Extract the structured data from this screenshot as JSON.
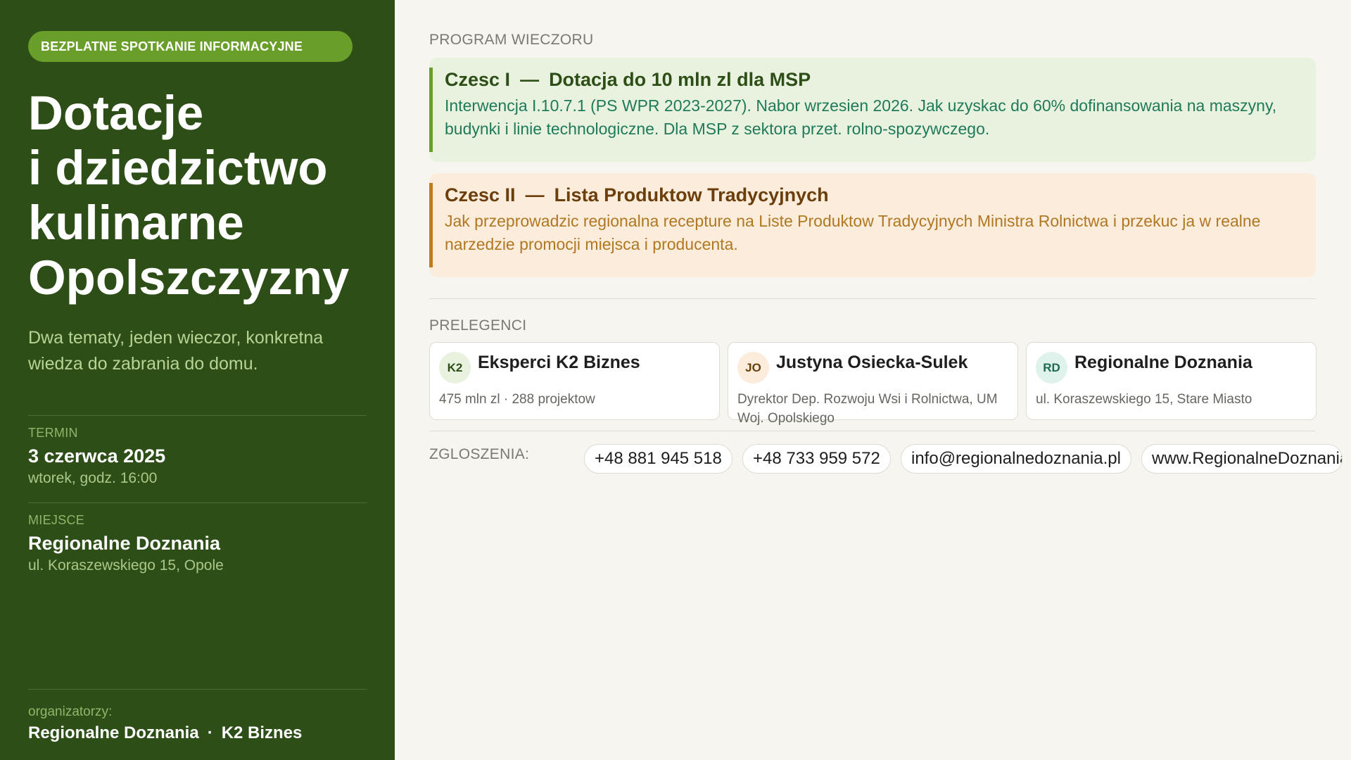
{
  "hero": {
    "badge": "BEZPLATNE SPOTKANIE INFORMACYJNE",
    "title_lines": [
      "Dotacje",
      "i dziedzictwo",
      "kulinarne",
      "Opolszczyzny"
    ],
    "lead": "Dwa tematy, jeden wieczor, konkretna wiedza do zabrania do domu."
  },
  "details": {
    "termin": {
      "label": "TERMIN",
      "main": "3 czerwca 2025",
      "sub": "wtorek, godz. 16:00"
    },
    "miejsce": {
      "label": "MIEJSCE",
      "main": "Regionalne Doznania",
      "sub": "ul. Koraszewskiego 15, Opole"
    }
  },
  "organizers": {
    "label": "organizatorzy:",
    "names": [
      "Regionalne Doznania",
      "K2 Biznes"
    ],
    "separator": "·"
  },
  "program": {
    "label": "PROGRAM WIECZORU",
    "parts": [
      {
        "part": "Czesc I",
        "dash": "—",
        "title": "Dotacja do 10 mln zl dla MSP",
        "description": "Interwencja I.10.7.1 (PS WPR 2023-2027). Nabor wrzesien 2026. Jak uzyskac do 60% dofinansowania na maszyny, budynki i linie technologiczne. Dla MSP z sektora przet. rolno-spozywczego."
      },
      {
        "part": "Czesc II",
        "dash": "—",
        "title": "Lista Produktow Tradycyjnych",
        "description": "Jak przeprowadzic regionalna recepture na Liste Produktow Tradycyjnych Ministra Rolnictwa i przekuc ja w realne narzedzie promocji miejsca i producenta."
      }
    ]
  },
  "speakers": {
    "label": "PRELEGENCI",
    "items": [
      {
        "initials": "K2",
        "name": "Eksperci K2 Biznes",
        "description": "475 mln zl · 288 projektow",
        "avatar_bg": "#e9f2df",
        "avatar_fg": "#2d4f17"
      },
      {
        "initials": "JO",
        "name": "Justyna Osiecka-Sulek",
        "description": "Dyrektor Dep. Rozwoju Wsi i Rolnictwa, UM Woj. Opolskiego",
        "avatar_bg": "#fbecdb",
        "avatar_fg": "#6b3f0c"
      },
      {
        "initials": "RD",
        "name": "Regionalne Doznania",
        "description": "ul. Koraszewskiego 15, Stare Miasto",
        "avatar_bg": "#dff2ec",
        "avatar_fg": "#1f6b4f"
      }
    ]
  },
  "contact": {
    "label": "ZGLOSZENIA:",
    "phone1": "+48 881 945 518",
    "phone2": "+48 733 959 572",
    "email": "info@regionalnedoznania.pl",
    "website": "www.RegionalneDoznania.pl"
  },
  "colors": {
    "sidebar_bg": "#2d4f17",
    "badge_bg": "#6a9e2a",
    "page_bg": "#f7f5f0",
    "part1_bg": "#e9f2df",
    "part1_accent": "#6a9e2a",
    "part2_bg": "#fbecdb",
    "part2_accent": "#c07a1e"
  }
}
